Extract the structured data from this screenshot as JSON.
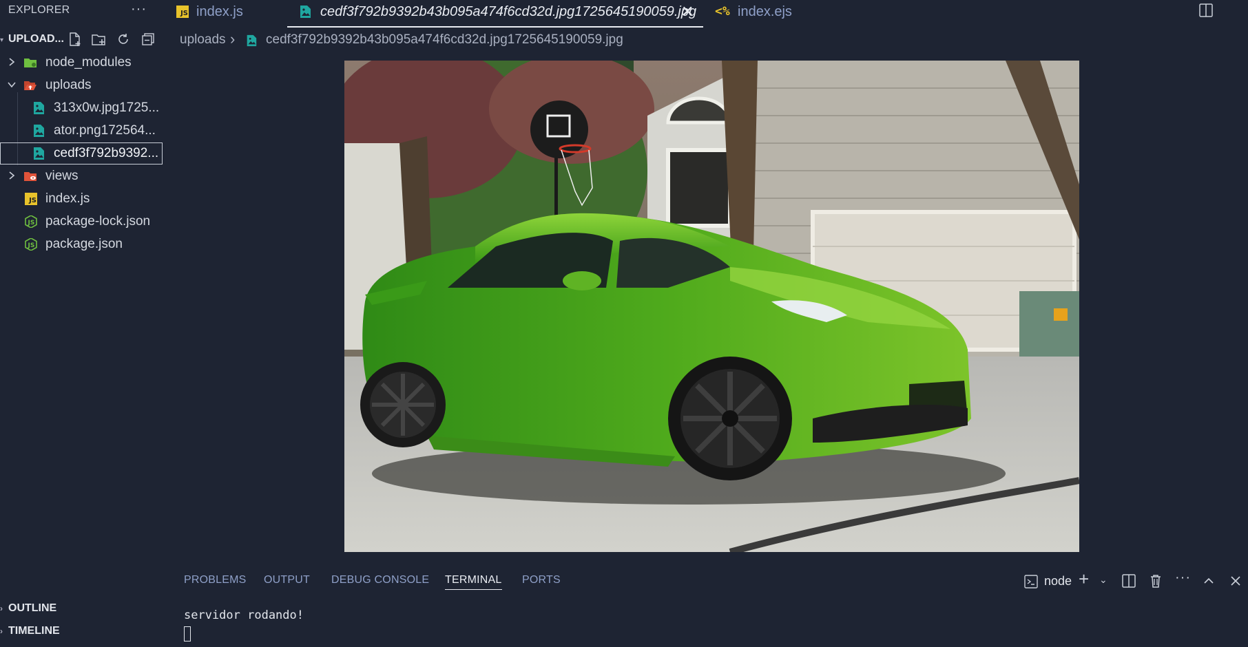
{
  "sidebar": {
    "title": "EXPLORER",
    "more": "···",
    "workspace": "UPLOAD...",
    "tree": [
      {
        "label": "node_modules",
        "kind": "folder",
        "icon": "green-folder-icon",
        "color": "#6fbf40"
      },
      {
        "label": "uploads",
        "kind": "folder-open",
        "icon": "red-folder-open-icon",
        "color": "#e0533a"
      },
      {
        "label": "313x0w.jpg1725...",
        "kind": "image",
        "icon": "image-file-icon"
      },
      {
        "label": "ator.png172564...",
        "kind": "image",
        "icon": "image-file-icon"
      },
      {
        "label": "cedf3f792b9392...",
        "kind": "image",
        "icon": "image-file-icon",
        "selected": true
      },
      {
        "label": "views",
        "kind": "folder",
        "icon": "red-views-folder-icon",
        "color": "#e0533a"
      },
      {
        "label": "index.js",
        "kind": "js",
        "icon": "javascript-file-icon"
      },
      {
        "label": "package-lock.json",
        "kind": "json",
        "icon": "nodejs-file-icon"
      },
      {
        "label": "package.json",
        "kind": "json",
        "icon": "nodejs-file-icon"
      }
    ],
    "sections": {
      "outline": "OUTLINE",
      "timeline": "TIMELINE"
    }
  },
  "tabs": [
    {
      "label": "index.js",
      "icon": "javascript-file-icon"
    },
    {
      "label": "cedf3f792b9392b43b095a474f6cd32d.jpg1725645190059.jpg",
      "icon": "image-file-icon",
      "active": true,
      "close": "✕"
    },
    {
      "label": "index.ejs",
      "icon": "ejs-file-icon"
    }
  ],
  "breadcrumb": {
    "folder": "uploads",
    "separator": "›",
    "file": "cedf3f792b9392b43b095a474f6cd32d.jpg1725645190059.jpg"
  },
  "preview": {
    "subject": "green sports car parked on driveway in front of house"
  },
  "panel": {
    "tabs": [
      "PROBLEMS",
      "OUTPUT",
      "DEBUG CONSOLE",
      "TERMINAL",
      "PORTS"
    ],
    "active_tab": "TERMINAL",
    "terminal_name": "node",
    "lines": [
      "servidor rodando!"
    ]
  },
  "colors": {
    "bg": "#1e2433",
    "accent_text": "#8fa0c8",
    "image_icon": "#1fa7a0",
    "js_badge": "#e8c32b"
  }
}
